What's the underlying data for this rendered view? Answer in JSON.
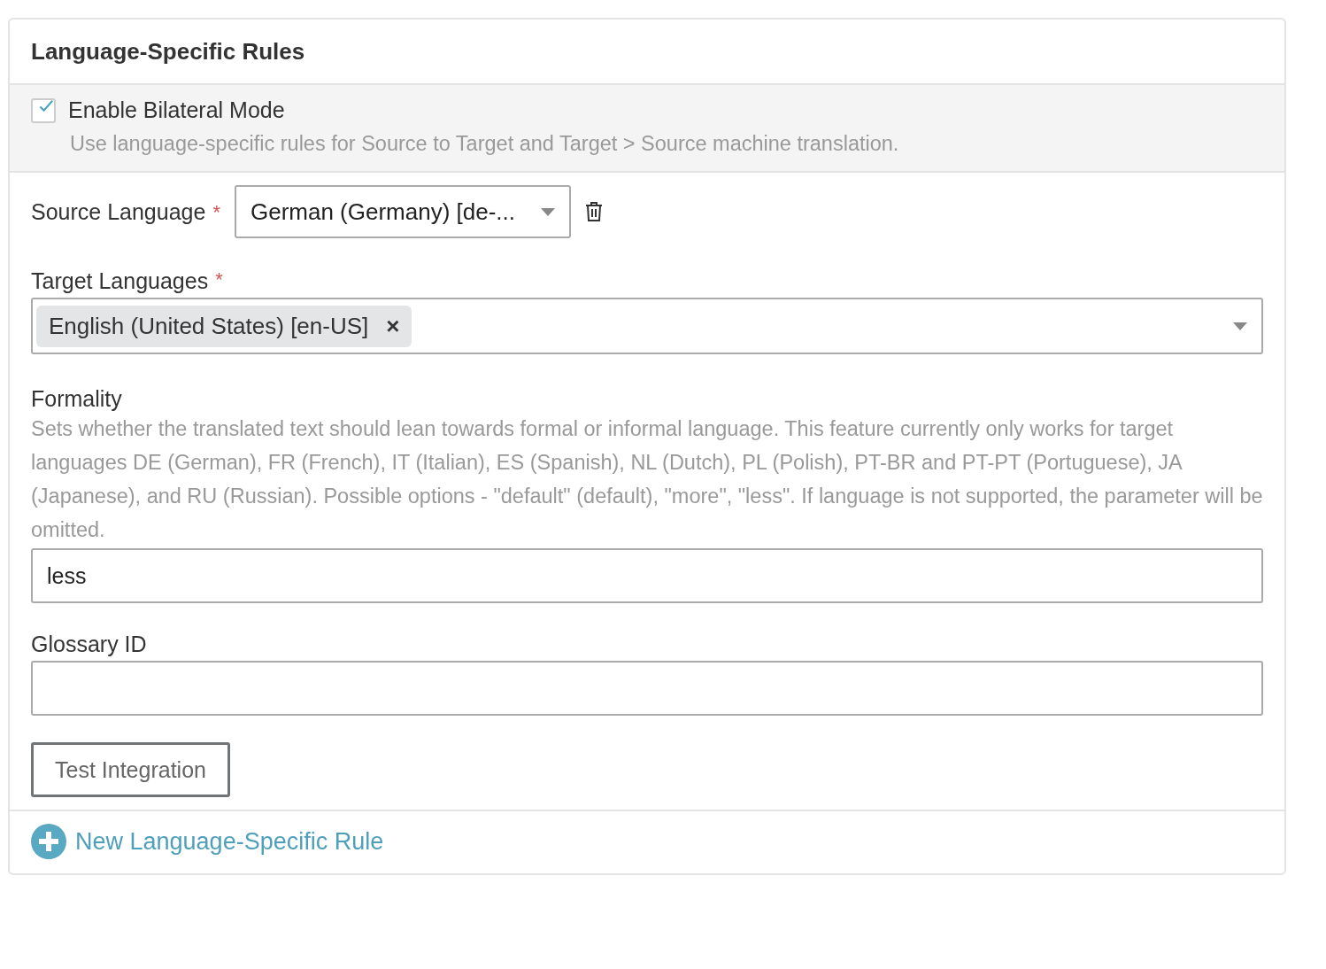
{
  "title": "Language-Specific Rules",
  "bilateral": {
    "label": "Enable Bilateral Mode",
    "checked": true,
    "description": "Use language-specific rules for Source to Target and Target > Source machine translation."
  },
  "source_language": {
    "label": "Source Language",
    "required_mark": "*",
    "value": "German (Germany) [de-..."
  },
  "target_languages": {
    "label": "Target Languages",
    "required_mark": "*",
    "tags": [
      {
        "text": "English (United States) [en-US]",
        "remove": "×"
      }
    ]
  },
  "formality": {
    "label": "Formality",
    "description": "Sets whether the translated text should lean towards formal or informal language. This feature currently only works for target languages DE (German), FR (French), IT (Italian), ES (Spanish), NL (Dutch), PL (Polish), PT-BR and PT-PT (Portuguese), JA (Japanese), and RU (Russian). Possible options - \"default\" (default), \"more\", \"less\". If language is not supported, the parameter will be omitted.",
    "value": "less"
  },
  "glossary": {
    "label": "Glossary ID"
  },
  "test_button": "Test Integration",
  "add_link": "New Language-Specific Rule"
}
